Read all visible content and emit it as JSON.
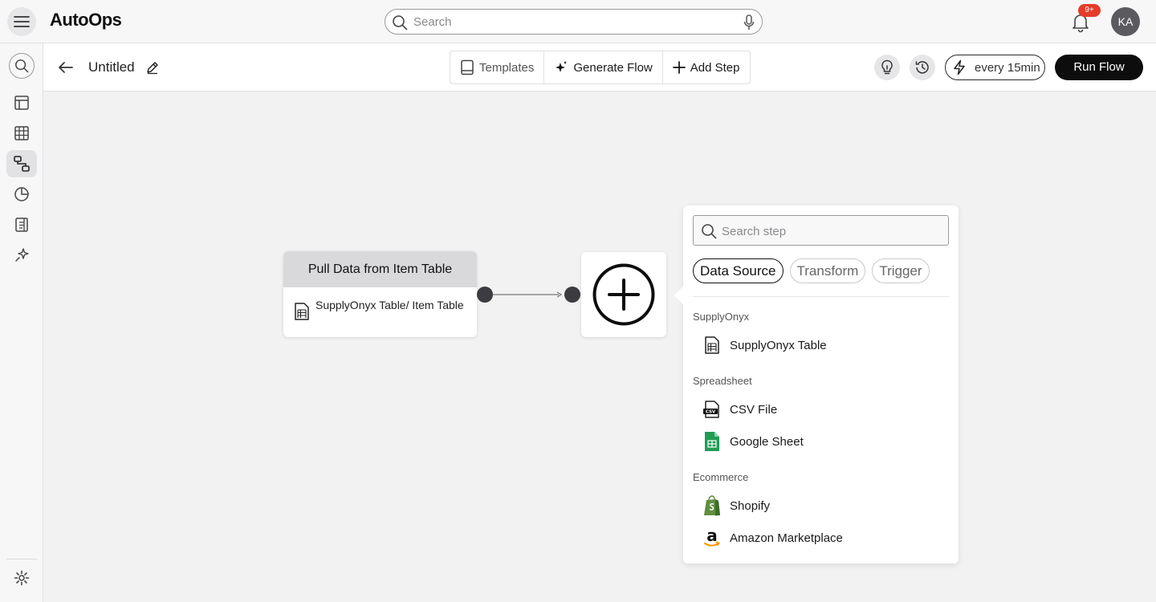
{
  "app": {
    "name": "AutoOps"
  },
  "search": {
    "placeholder": "Search"
  },
  "notifications": {
    "badge": "9+"
  },
  "user": {
    "initials": "KA"
  },
  "flow": {
    "title": "Untitled",
    "toolbar": {
      "templates_label": "Templates",
      "generate_label": "Generate Flow",
      "add_step_label": "Add Step"
    },
    "schedule_label": "every 15min",
    "run_label": "Run Flow"
  },
  "canvas": {
    "node": {
      "title": "Pull Data from Item Table",
      "source": "SupplyOnyx Table/ Item Table"
    }
  },
  "step_picker": {
    "search_placeholder": "Search step",
    "tabs": [
      {
        "label": "Data Source",
        "active": true
      },
      {
        "label": "Transform",
        "active": false
      },
      {
        "label": "Trigger",
        "active": false
      }
    ],
    "groups": [
      {
        "label": "SupplyOnyx",
        "items": [
          {
            "label": "SupplyOnyx Table",
            "icon": "table-icon"
          }
        ]
      },
      {
        "label": "Spreadsheet",
        "items": [
          {
            "label": "CSV File",
            "icon": "csv-file-icon"
          },
          {
            "label": "Google Sheet",
            "icon": "google-sheet-icon"
          }
        ]
      },
      {
        "label": "Ecommerce",
        "items": [
          {
            "label": "Shopify",
            "icon": "shopify-icon"
          },
          {
            "label": "Amazon Marketplace",
            "icon": "amazon-icon"
          }
        ]
      }
    ]
  },
  "colors": {
    "accent_dark": "#0d0d0d",
    "badge_red": "#e53c2a",
    "node_header": "#d9d9db",
    "sheet_green": "#1f9d55",
    "shopify_green": "#5e8e3e",
    "amazon_orange": "#f79400"
  }
}
